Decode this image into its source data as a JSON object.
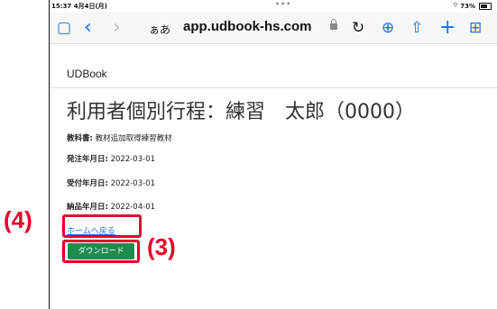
{
  "status": {
    "time": "15:37",
    "date": "4月4日(月)",
    "dots": "•••",
    "wifi": "⌔",
    "battery": "73%"
  },
  "toolbar": {
    "sidebar_icon": "▢",
    "back_icon": "‹",
    "forward_icon": "›",
    "aa": "ぁあ",
    "url": "app.udbook-hs.com",
    "reload_icon": "↻",
    "download_icon": "⊕",
    "share_icon": "⇧",
    "newtab_icon": "+",
    "tabs_icon": "⊞"
  },
  "page": {
    "brand": "UDBook",
    "title": "利用者個別行程：練習　太郎（0000）",
    "fields": [
      {
        "label": "教科書:",
        "value": " 教材追加取得練習教材"
      },
      {
        "label": "発注年月日:",
        "value": " 2022-03-01"
      },
      {
        "label": "受付年月日:",
        "value": " 2022-03-01"
      },
      {
        "label": "納品年月日:",
        "value": " 2022-04-01"
      }
    ],
    "home_link": "ホームへ戻る",
    "download_button": "ダウンロード"
  },
  "annotations": {
    "callout_home": "(4)",
    "callout_download": "(3)",
    "color": "#e4002b"
  }
}
